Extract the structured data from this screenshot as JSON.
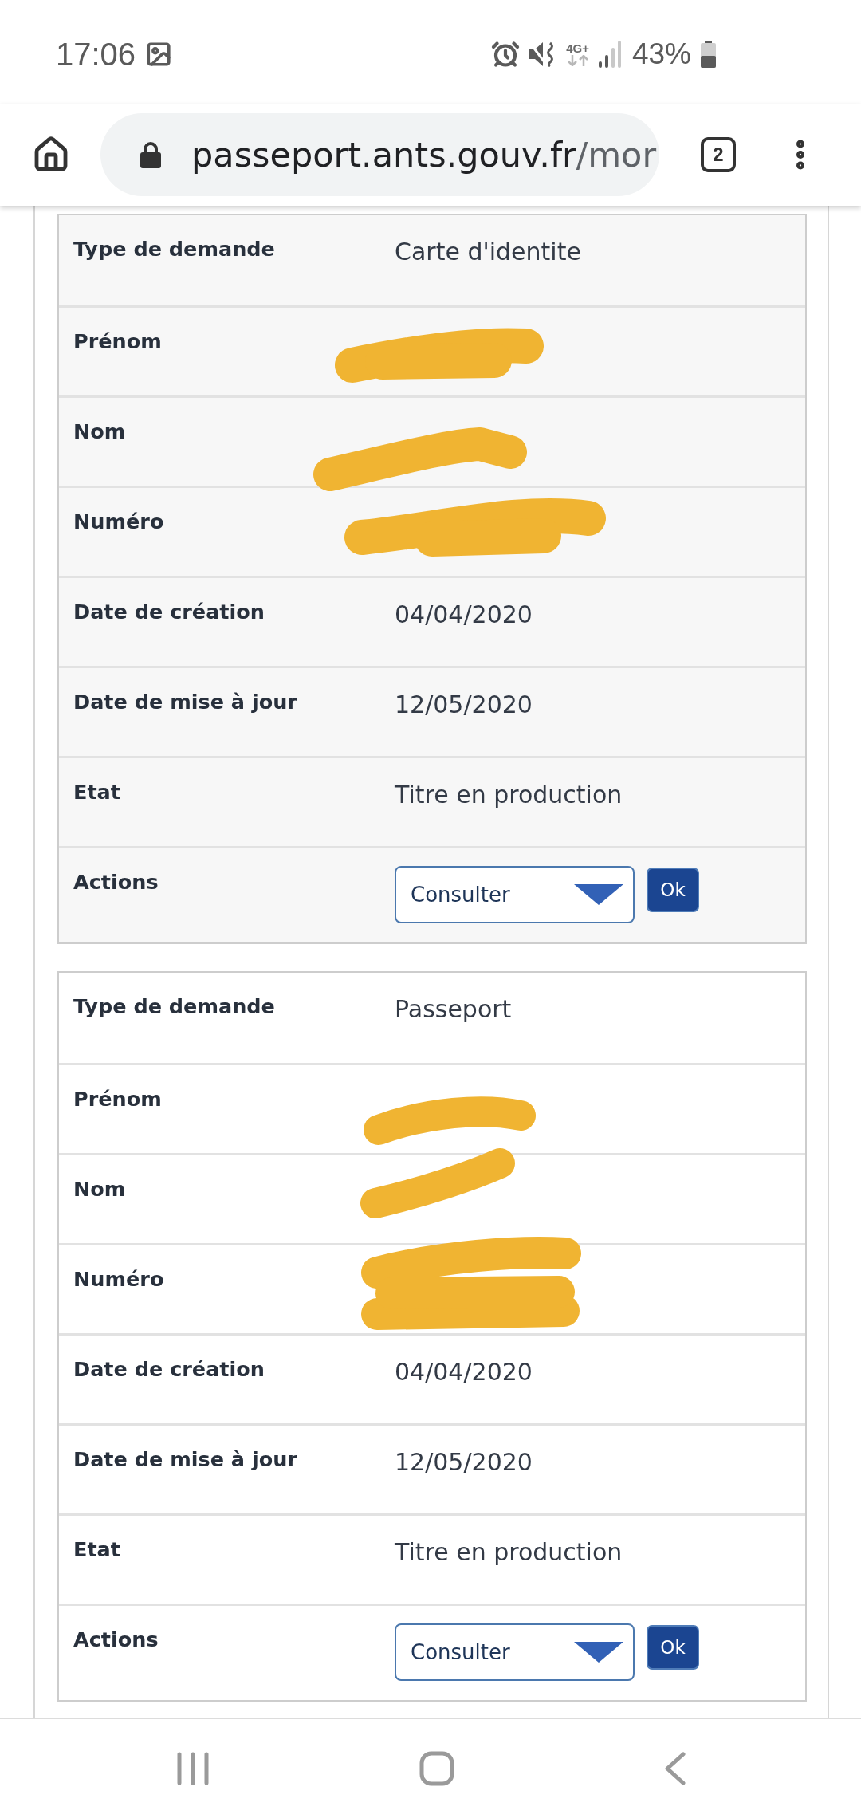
{
  "status_bar": {
    "time": "17:06",
    "network": "4G+",
    "battery": "43%"
  },
  "browser": {
    "url_host": "passeport.ants.gouv.fr",
    "url_path": "/mor",
    "tab_count": "2"
  },
  "requests": [
    {
      "rows": [
        {
          "kind": "text",
          "label": "Type de demande",
          "value": "Carte d'identite"
        },
        {
          "kind": "redacted",
          "label": "Prénom"
        },
        {
          "kind": "redacted",
          "label": "Nom"
        },
        {
          "kind": "redacted",
          "label": "Numéro"
        },
        {
          "kind": "text",
          "label": "Date de création",
          "value": "04/04/2020"
        },
        {
          "kind": "text",
          "label": "Date de mise à jour",
          "value": "12/05/2020"
        },
        {
          "kind": "text",
          "label": "Etat",
          "value": "Titre en production"
        },
        {
          "kind": "actions",
          "label": "Actions",
          "select": "Consulter",
          "button": "Ok"
        }
      ]
    },
    {
      "rows": [
        {
          "kind": "text",
          "label": "Type de demande",
          "value": "Passeport"
        },
        {
          "kind": "redacted",
          "label": "Prénom"
        },
        {
          "kind": "redacted",
          "label": "Nom"
        },
        {
          "kind": "redacted",
          "label": "Numéro"
        },
        {
          "kind": "text",
          "label": "Date de création",
          "value": "04/04/2020"
        },
        {
          "kind": "text",
          "label": "Date de mise à jour",
          "value": "12/05/2020"
        },
        {
          "kind": "text",
          "label": "Etat",
          "value": "Titre en production"
        },
        {
          "kind": "actions",
          "label": "Actions",
          "select": "Consulter",
          "button": "Ok"
        }
      ]
    }
  ]
}
